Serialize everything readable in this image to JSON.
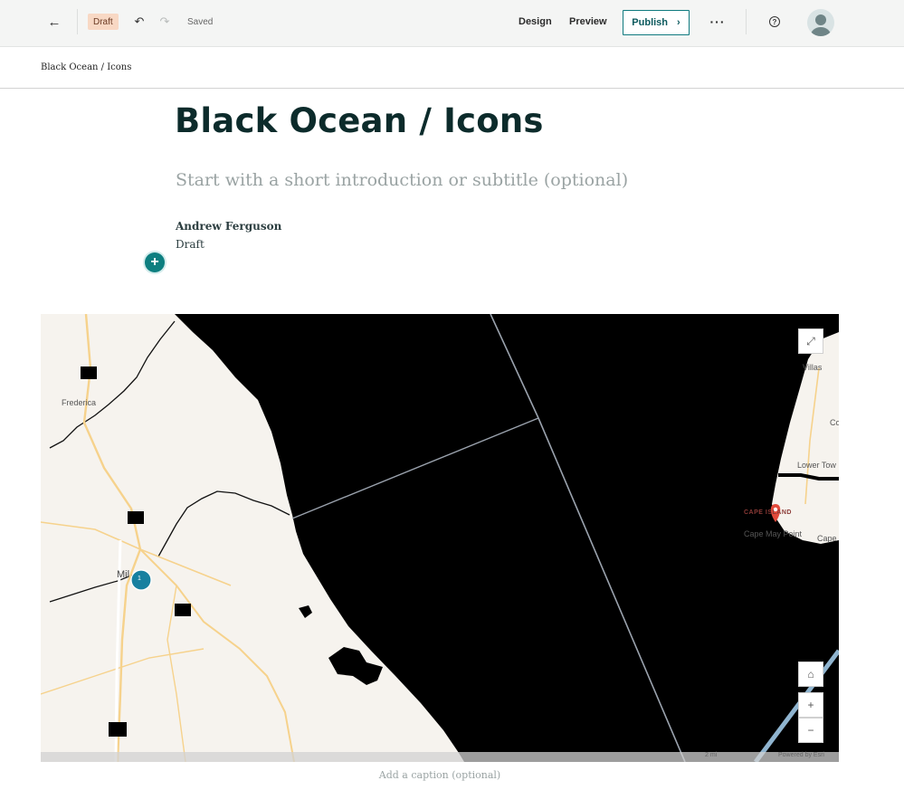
{
  "toolbar": {
    "back_icon": "arrow-left-icon",
    "badge": "Draft",
    "undo_icon": "undo-icon",
    "redo_icon": "redo-icon",
    "saved": "Saved",
    "design": "Design",
    "preview": "Preview",
    "publish": "Publish",
    "more_icon": "ellipsis-icon",
    "help_icon": "question-circle-icon",
    "avatar_icon": "user-avatar-icon"
  },
  "breadcrumb": "Black Ocean / Icons",
  "story": {
    "title": "Black Ocean / Icons",
    "subtitle_placeholder": "Start with a short introduction or subtitle (optional)",
    "author": "Andrew Ferguson",
    "status": "Draft",
    "add_block_icon": "plus-icon"
  },
  "map": {
    "labels": {
      "frederica": "Frederica",
      "villas": "Villas",
      "lower_town": "Lower Tow",
      "cape_may_point": "Cape May Point",
      "cape": "Cape",
      "co": "Co",
      "milford": "Mil"
    },
    "pin_label": "CAPE ISLAND",
    "cluster_count": "1",
    "scale": "2 mi",
    "attribution": "Powered by Esri",
    "buttons": {
      "fullscreen_icon": "expand-icon",
      "home_icon": "home-icon",
      "zoom_in": "+",
      "zoom_out": "−"
    },
    "colors": {
      "water": "#000000",
      "land": "#f6f3ee",
      "roads": "#f6d28c",
      "marker": "#1780a0",
      "pin": "#e24a3b"
    }
  },
  "caption_placeholder": "Add a caption (optional)"
}
